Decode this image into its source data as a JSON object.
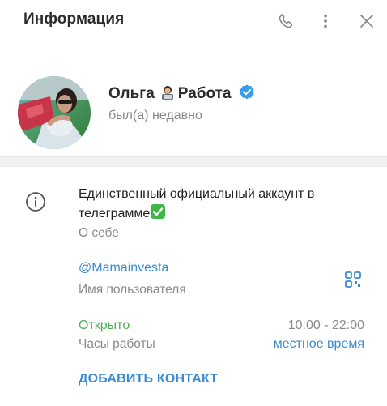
{
  "header": {
    "title": "Информация",
    "icons": [
      "phone-icon",
      "more-vertical-icon",
      "close-icon"
    ]
  },
  "profile": {
    "name_first": "Ольга",
    "name_second": "Работа",
    "name_emoji": "technologist-emoji",
    "status": "был(а) недавно",
    "verified_color": "#3a9ee8"
  },
  "about": {
    "bio_line1": "Единственный официальный аккаунт в",
    "bio_line2": "телеграмме",
    "bio_emoji": "check-mark-button-emoji",
    "bio_caption": "О себе"
  },
  "username": {
    "value": "@Mamainvesta",
    "caption": "Имя пользователя",
    "qr_icon": "qr-code-icon"
  },
  "hours": {
    "status": "Открыто",
    "range": "10:00 - 22:00",
    "caption": "Часы работы",
    "local_time_link": "местное время"
  },
  "actions": {
    "add_contact": "ДОБАВИТЬ КОНТАКТ"
  },
  "colors": {
    "accent": "#3a8bd0",
    "open_green": "#4caf50",
    "secondary_text": "#8a8a8a"
  }
}
